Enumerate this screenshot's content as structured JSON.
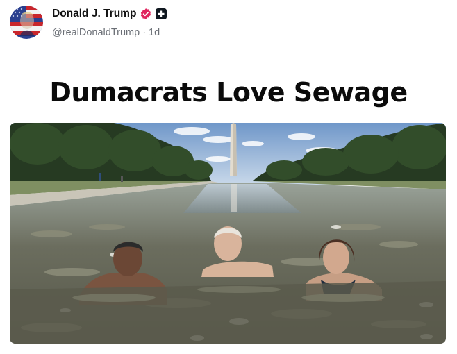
{
  "post": {
    "author": {
      "display_name": "Donald J. Trump",
      "handle": "@realDonaldTrump",
      "separator": "·",
      "time_ago": "1d",
      "avatar_icon": "flag-portrait-avatar",
      "verified_icon": "verified-badge-icon",
      "verified_color": "#e0245e",
      "org_icon": "plus-badge-icon"
    },
    "headline": "Dumacrats Love Sewage",
    "media": {
      "type": "photo",
      "icon": "photo-image"
    }
  },
  "colors": {
    "text": "#111111",
    "muted": "#6b6f76",
    "background": "#ffffff"
  }
}
